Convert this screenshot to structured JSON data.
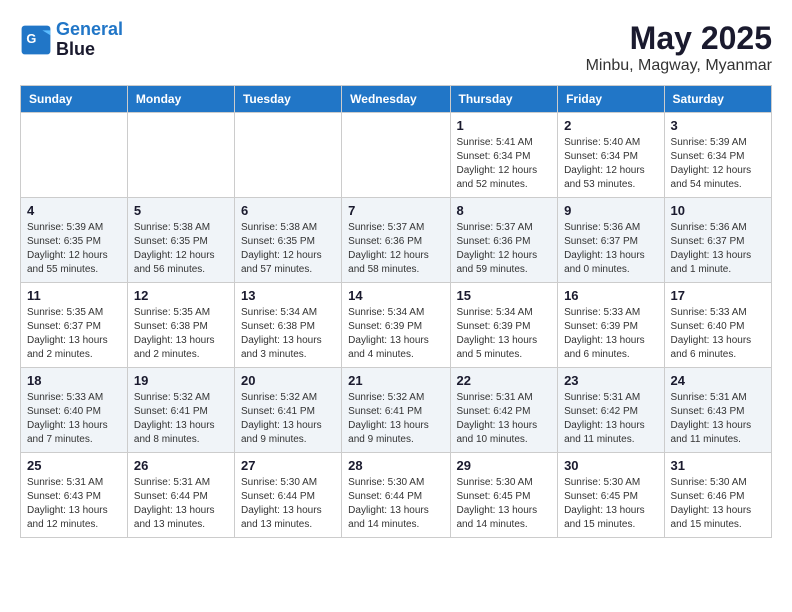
{
  "logo": {
    "line1": "General",
    "line2": "Blue"
  },
  "title": "May 2025",
  "location": "Minbu, Magway, Myanmar",
  "days_of_week": [
    "Sunday",
    "Monday",
    "Tuesday",
    "Wednesday",
    "Thursday",
    "Friday",
    "Saturday"
  ],
  "weeks": [
    [
      {
        "day": "",
        "info": ""
      },
      {
        "day": "",
        "info": ""
      },
      {
        "day": "",
        "info": ""
      },
      {
        "day": "",
        "info": ""
      },
      {
        "day": "1",
        "info": "Sunrise: 5:41 AM\nSunset: 6:34 PM\nDaylight: 12 hours\nand 52 minutes."
      },
      {
        "day": "2",
        "info": "Sunrise: 5:40 AM\nSunset: 6:34 PM\nDaylight: 12 hours\nand 53 minutes."
      },
      {
        "day": "3",
        "info": "Sunrise: 5:39 AM\nSunset: 6:34 PM\nDaylight: 12 hours\nand 54 minutes."
      }
    ],
    [
      {
        "day": "4",
        "info": "Sunrise: 5:39 AM\nSunset: 6:35 PM\nDaylight: 12 hours\nand 55 minutes."
      },
      {
        "day": "5",
        "info": "Sunrise: 5:38 AM\nSunset: 6:35 PM\nDaylight: 12 hours\nand 56 minutes."
      },
      {
        "day": "6",
        "info": "Sunrise: 5:38 AM\nSunset: 6:35 PM\nDaylight: 12 hours\nand 57 minutes."
      },
      {
        "day": "7",
        "info": "Sunrise: 5:37 AM\nSunset: 6:36 PM\nDaylight: 12 hours\nand 58 minutes."
      },
      {
        "day": "8",
        "info": "Sunrise: 5:37 AM\nSunset: 6:36 PM\nDaylight: 12 hours\nand 59 minutes."
      },
      {
        "day": "9",
        "info": "Sunrise: 5:36 AM\nSunset: 6:37 PM\nDaylight: 13 hours\nand 0 minutes."
      },
      {
        "day": "10",
        "info": "Sunrise: 5:36 AM\nSunset: 6:37 PM\nDaylight: 13 hours\nand 1 minute."
      }
    ],
    [
      {
        "day": "11",
        "info": "Sunrise: 5:35 AM\nSunset: 6:37 PM\nDaylight: 13 hours\nand 2 minutes."
      },
      {
        "day": "12",
        "info": "Sunrise: 5:35 AM\nSunset: 6:38 PM\nDaylight: 13 hours\nand 2 minutes."
      },
      {
        "day": "13",
        "info": "Sunrise: 5:34 AM\nSunset: 6:38 PM\nDaylight: 13 hours\nand 3 minutes."
      },
      {
        "day": "14",
        "info": "Sunrise: 5:34 AM\nSunset: 6:39 PM\nDaylight: 13 hours\nand 4 minutes."
      },
      {
        "day": "15",
        "info": "Sunrise: 5:34 AM\nSunset: 6:39 PM\nDaylight: 13 hours\nand 5 minutes."
      },
      {
        "day": "16",
        "info": "Sunrise: 5:33 AM\nSunset: 6:39 PM\nDaylight: 13 hours\nand 6 minutes."
      },
      {
        "day": "17",
        "info": "Sunrise: 5:33 AM\nSunset: 6:40 PM\nDaylight: 13 hours\nand 6 minutes."
      }
    ],
    [
      {
        "day": "18",
        "info": "Sunrise: 5:33 AM\nSunset: 6:40 PM\nDaylight: 13 hours\nand 7 minutes."
      },
      {
        "day": "19",
        "info": "Sunrise: 5:32 AM\nSunset: 6:41 PM\nDaylight: 13 hours\nand 8 minutes."
      },
      {
        "day": "20",
        "info": "Sunrise: 5:32 AM\nSunset: 6:41 PM\nDaylight: 13 hours\nand 9 minutes."
      },
      {
        "day": "21",
        "info": "Sunrise: 5:32 AM\nSunset: 6:41 PM\nDaylight: 13 hours\nand 9 minutes."
      },
      {
        "day": "22",
        "info": "Sunrise: 5:31 AM\nSunset: 6:42 PM\nDaylight: 13 hours\nand 10 minutes."
      },
      {
        "day": "23",
        "info": "Sunrise: 5:31 AM\nSunset: 6:42 PM\nDaylight: 13 hours\nand 11 minutes."
      },
      {
        "day": "24",
        "info": "Sunrise: 5:31 AM\nSunset: 6:43 PM\nDaylight: 13 hours\nand 11 minutes."
      }
    ],
    [
      {
        "day": "25",
        "info": "Sunrise: 5:31 AM\nSunset: 6:43 PM\nDaylight: 13 hours\nand 12 minutes."
      },
      {
        "day": "26",
        "info": "Sunrise: 5:31 AM\nSunset: 6:44 PM\nDaylight: 13 hours\nand 13 minutes."
      },
      {
        "day": "27",
        "info": "Sunrise: 5:30 AM\nSunset: 6:44 PM\nDaylight: 13 hours\nand 13 minutes."
      },
      {
        "day": "28",
        "info": "Sunrise: 5:30 AM\nSunset: 6:44 PM\nDaylight: 13 hours\nand 14 minutes."
      },
      {
        "day": "29",
        "info": "Sunrise: 5:30 AM\nSunset: 6:45 PM\nDaylight: 13 hours\nand 14 minutes."
      },
      {
        "day": "30",
        "info": "Sunrise: 5:30 AM\nSunset: 6:45 PM\nDaylight: 13 hours\nand 15 minutes."
      },
      {
        "day": "31",
        "info": "Sunrise: 5:30 AM\nSunset: 6:46 PM\nDaylight: 13 hours\nand 15 minutes."
      }
    ]
  ]
}
